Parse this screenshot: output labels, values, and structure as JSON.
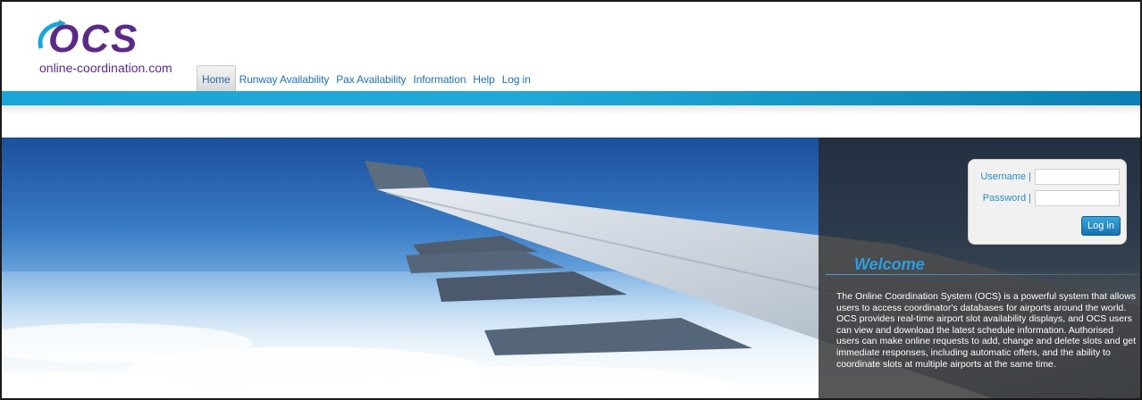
{
  "brand": {
    "logo_text": "OCS",
    "domain": "online-coordination.com",
    "colors": {
      "purple": "#5b2a86",
      "blue": "#1aa6d6"
    }
  },
  "nav": {
    "items": [
      {
        "label": "Home",
        "active": true
      },
      {
        "label": "Runway Availability",
        "active": false
      },
      {
        "label": "Pax Availability",
        "active": false
      },
      {
        "label": "Information",
        "active": false
      },
      {
        "label": "Help",
        "active": false
      },
      {
        "label": "Log in",
        "active": false
      }
    ]
  },
  "login": {
    "username_label": "Username |",
    "password_label": "Password |",
    "username_value": "",
    "password_value": "",
    "submit_label": "Log in"
  },
  "welcome": {
    "title": "Welcome",
    "body": "The Online Coordination System (OCS) is a powerful system that allows users to access coordinator's databases for airports around the world. OCS provides real-time airport slot availability displays, and OCS users can view and download the latest schedule information. Authorised users can make online requests to add, change and delete slots and get immediate responses, including automatic offers, and the ability to coordinate slots at multiple airports at the same time."
  },
  "hero": {
    "image": "airplane-wing-photo"
  }
}
